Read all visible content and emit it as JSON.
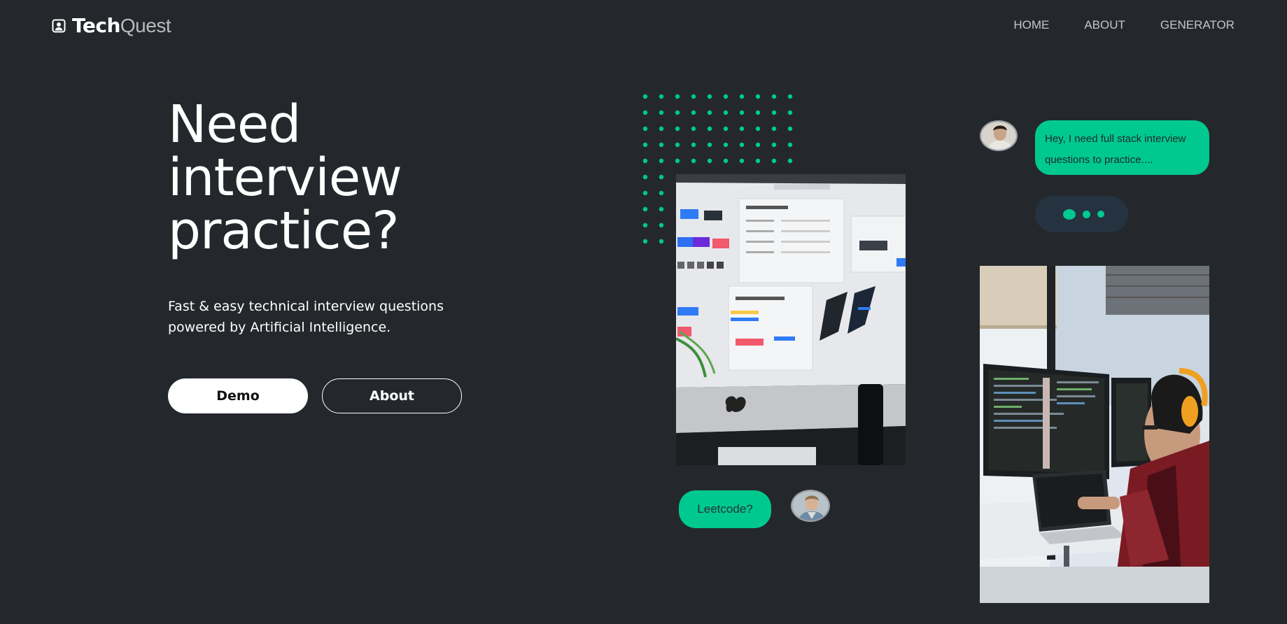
{
  "nav": {
    "brand_bold": "Tech",
    "brand_light": "Quest",
    "links": [
      "HOME",
      "ABOUT",
      "GENERATOR"
    ]
  },
  "hero": {
    "title_lines": [
      "Need",
      "interview",
      "practice?"
    ],
    "subtitle_line1": "Fast & easy technical interview questions",
    "subtitle_line2": "powered by Artificial Intelligence.",
    "demo_label": "Demo",
    "about_label": "About"
  },
  "chat": {
    "message": "Hey, I need full stack interview questions to practice....",
    "reply": "Leetcode?"
  },
  "colors": {
    "background": "#24282c",
    "accent": "#00c98f",
    "typing_bubble": "#253240"
  },
  "icons": {
    "logo": "user-badge-icon"
  }
}
